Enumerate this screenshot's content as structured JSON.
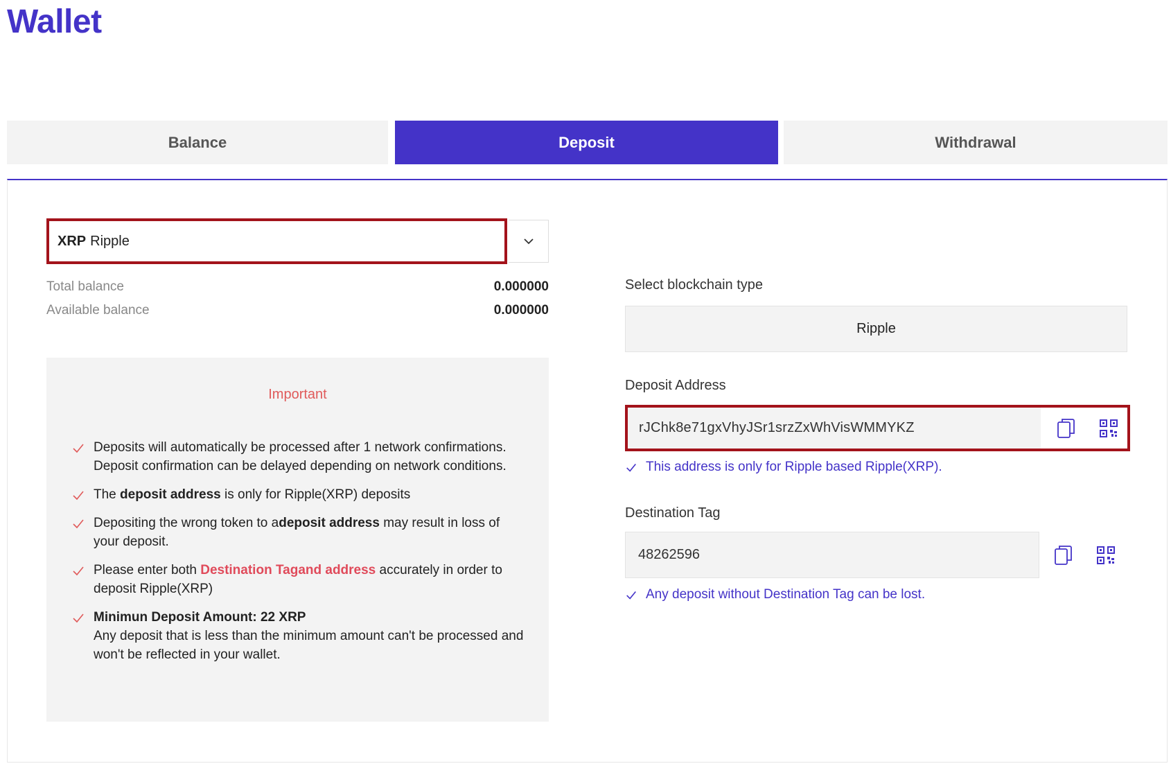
{
  "page": {
    "title": "Wallet"
  },
  "tabs": [
    {
      "label": "Balance"
    },
    {
      "label": "Deposit"
    },
    {
      "label": "Withdrawal"
    }
  ],
  "coin": {
    "symbol": "XRP",
    "name": "Ripple"
  },
  "balances": {
    "total_label": "Total balance",
    "total_value": "0.000000",
    "available_label": "Available balance",
    "available_value": "0.000000"
  },
  "important": {
    "title": "Important",
    "note1": "Deposits will automatically be processed after 1 network confirmations. Deposit confirmation can be delayed depending on network conditions.",
    "note2_pre": "The ",
    "note2_bold": "deposit address",
    "note2_post": " is only for Ripple(XRP) deposits",
    "note3_pre": "Depositing the wrong token to a",
    "note3_bold": "deposit address",
    "note3_post": " may result in loss of your deposit.",
    "note4_pre": "Please enter both ",
    "note4_red": "Destination Tagand address",
    "note4_post": " accurately in order to deposit Ripple(XRP)",
    "note5_bold": "Minimun Deposit Amount: 22 XRP",
    "note5_text": "Any deposit that is less than the minimum amount can't be processed and won't be reflected in your wallet."
  },
  "blockchain": {
    "label": "Select blockchain type",
    "value": "Ripple"
  },
  "deposit_address": {
    "label": "Deposit Address",
    "value": "rJChk8e71gxVhyJSr1srzZxWhVisWMMYKZ",
    "hint": "This address is only for Ripple based Ripple(XRP)."
  },
  "destination_tag": {
    "label": "Destination Tag",
    "value": "48262596",
    "hint": "Any deposit without Destination Tag can be lost."
  },
  "colors": {
    "accent": "#4433c8",
    "highlight_border": "#a3131b",
    "warning": "#e05a5a"
  },
  "icons": {
    "copy": "copy-icon",
    "qr": "qr-code-icon",
    "check": "check-icon",
    "dropdown": "chevron-down-icon"
  }
}
